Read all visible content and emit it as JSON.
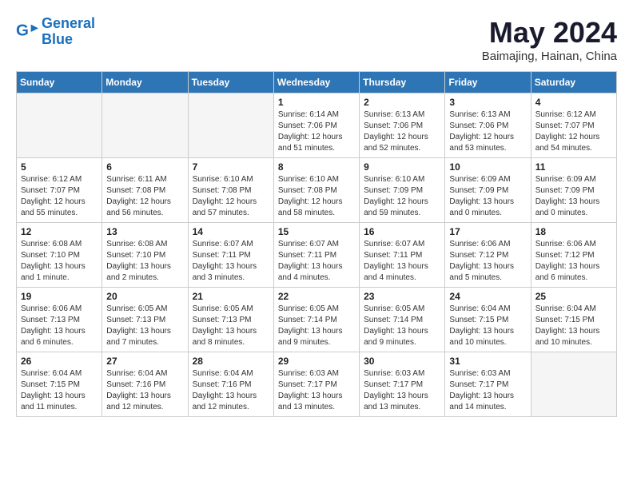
{
  "header": {
    "logo_line1": "General",
    "logo_line2": "Blue",
    "month": "May 2024",
    "location": "Baimajing, Hainan, China"
  },
  "days_of_week": [
    "Sunday",
    "Monday",
    "Tuesday",
    "Wednesday",
    "Thursday",
    "Friday",
    "Saturday"
  ],
  "weeks": [
    [
      {
        "num": "",
        "info": "",
        "empty": true
      },
      {
        "num": "",
        "info": "",
        "empty": true
      },
      {
        "num": "",
        "info": "",
        "empty": true
      },
      {
        "num": "1",
        "info": "Sunrise: 6:14 AM\nSunset: 7:06 PM\nDaylight: 12 hours\nand 51 minutes."
      },
      {
        "num": "2",
        "info": "Sunrise: 6:13 AM\nSunset: 7:06 PM\nDaylight: 12 hours\nand 52 minutes."
      },
      {
        "num": "3",
        "info": "Sunrise: 6:13 AM\nSunset: 7:06 PM\nDaylight: 12 hours\nand 53 minutes."
      },
      {
        "num": "4",
        "info": "Sunrise: 6:12 AM\nSunset: 7:07 PM\nDaylight: 12 hours\nand 54 minutes."
      }
    ],
    [
      {
        "num": "5",
        "info": "Sunrise: 6:12 AM\nSunset: 7:07 PM\nDaylight: 12 hours\nand 55 minutes."
      },
      {
        "num": "6",
        "info": "Sunrise: 6:11 AM\nSunset: 7:08 PM\nDaylight: 12 hours\nand 56 minutes."
      },
      {
        "num": "7",
        "info": "Sunrise: 6:10 AM\nSunset: 7:08 PM\nDaylight: 12 hours\nand 57 minutes."
      },
      {
        "num": "8",
        "info": "Sunrise: 6:10 AM\nSunset: 7:08 PM\nDaylight: 12 hours\nand 58 minutes."
      },
      {
        "num": "9",
        "info": "Sunrise: 6:10 AM\nSunset: 7:09 PM\nDaylight: 12 hours\nand 59 minutes."
      },
      {
        "num": "10",
        "info": "Sunrise: 6:09 AM\nSunset: 7:09 PM\nDaylight: 13 hours\nand 0 minutes."
      },
      {
        "num": "11",
        "info": "Sunrise: 6:09 AM\nSunset: 7:09 PM\nDaylight: 13 hours\nand 0 minutes."
      }
    ],
    [
      {
        "num": "12",
        "info": "Sunrise: 6:08 AM\nSunset: 7:10 PM\nDaylight: 13 hours\nand 1 minute."
      },
      {
        "num": "13",
        "info": "Sunrise: 6:08 AM\nSunset: 7:10 PM\nDaylight: 13 hours\nand 2 minutes."
      },
      {
        "num": "14",
        "info": "Sunrise: 6:07 AM\nSunset: 7:11 PM\nDaylight: 13 hours\nand 3 minutes."
      },
      {
        "num": "15",
        "info": "Sunrise: 6:07 AM\nSunset: 7:11 PM\nDaylight: 13 hours\nand 4 minutes."
      },
      {
        "num": "16",
        "info": "Sunrise: 6:07 AM\nSunset: 7:11 PM\nDaylight: 13 hours\nand 4 minutes."
      },
      {
        "num": "17",
        "info": "Sunrise: 6:06 AM\nSunset: 7:12 PM\nDaylight: 13 hours\nand 5 minutes."
      },
      {
        "num": "18",
        "info": "Sunrise: 6:06 AM\nSunset: 7:12 PM\nDaylight: 13 hours\nand 6 minutes."
      }
    ],
    [
      {
        "num": "19",
        "info": "Sunrise: 6:06 AM\nSunset: 7:13 PM\nDaylight: 13 hours\nand 6 minutes."
      },
      {
        "num": "20",
        "info": "Sunrise: 6:05 AM\nSunset: 7:13 PM\nDaylight: 13 hours\nand 7 minutes."
      },
      {
        "num": "21",
        "info": "Sunrise: 6:05 AM\nSunset: 7:13 PM\nDaylight: 13 hours\nand 8 minutes."
      },
      {
        "num": "22",
        "info": "Sunrise: 6:05 AM\nSunset: 7:14 PM\nDaylight: 13 hours\nand 9 minutes."
      },
      {
        "num": "23",
        "info": "Sunrise: 6:05 AM\nSunset: 7:14 PM\nDaylight: 13 hours\nand 9 minutes."
      },
      {
        "num": "24",
        "info": "Sunrise: 6:04 AM\nSunset: 7:15 PM\nDaylight: 13 hours\nand 10 minutes."
      },
      {
        "num": "25",
        "info": "Sunrise: 6:04 AM\nSunset: 7:15 PM\nDaylight: 13 hours\nand 10 minutes."
      }
    ],
    [
      {
        "num": "26",
        "info": "Sunrise: 6:04 AM\nSunset: 7:15 PM\nDaylight: 13 hours\nand 11 minutes."
      },
      {
        "num": "27",
        "info": "Sunrise: 6:04 AM\nSunset: 7:16 PM\nDaylight: 13 hours\nand 12 minutes."
      },
      {
        "num": "28",
        "info": "Sunrise: 6:04 AM\nSunset: 7:16 PM\nDaylight: 13 hours\nand 12 minutes."
      },
      {
        "num": "29",
        "info": "Sunrise: 6:03 AM\nSunset: 7:17 PM\nDaylight: 13 hours\nand 13 minutes."
      },
      {
        "num": "30",
        "info": "Sunrise: 6:03 AM\nSunset: 7:17 PM\nDaylight: 13 hours\nand 13 minutes."
      },
      {
        "num": "31",
        "info": "Sunrise: 6:03 AM\nSunset: 7:17 PM\nDaylight: 13 hours\nand 14 minutes."
      },
      {
        "num": "",
        "info": "",
        "empty": true
      }
    ]
  ]
}
